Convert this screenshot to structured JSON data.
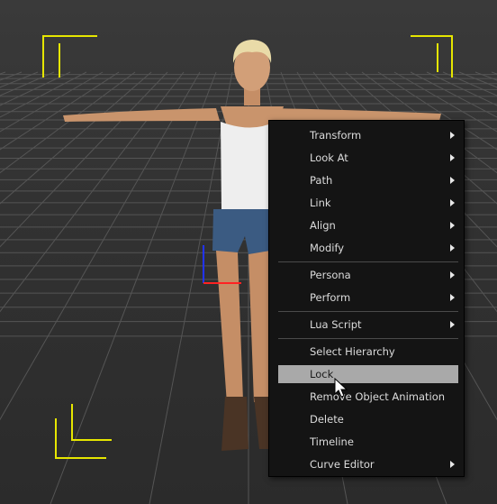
{
  "context_menu": {
    "items": [
      {
        "label": "Transform",
        "submenu": true
      },
      {
        "label": "Look At",
        "submenu": true
      },
      {
        "label": "Path",
        "submenu": true
      },
      {
        "label": "Link",
        "submenu": true
      },
      {
        "label": "Align",
        "submenu": true
      },
      {
        "label": "Modify",
        "submenu": true
      },
      {
        "label": "Persona",
        "submenu": true
      },
      {
        "label": "Perform",
        "submenu": true
      },
      {
        "label": "Lua Script",
        "submenu": true
      },
      {
        "label": "Select Hierarchy",
        "submenu": false
      },
      {
        "label": "Lock",
        "submenu": false,
        "highlighted": true
      },
      {
        "label": "Remove Object Animation",
        "submenu": false
      },
      {
        "label": "Delete",
        "submenu": false
      },
      {
        "label": "Timeline",
        "submenu": false
      },
      {
        "label": "Curve Editor",
        "submenu": true
      }
    ]
  },
  "colors": {
    "viewport_corner_markers": "#e6e600",
    "menu_background": "#141414",
    "menu_highlight": "#a9a9a9",
    "gizmo_y_axis": "#2233ff",
    "gizmo_x_axis": "#ff2222"
  },
  "icons": {
    "pointer": "mouse-cursor-icon",
    "submenu": "submenu-arrow-icon"
  }
}
